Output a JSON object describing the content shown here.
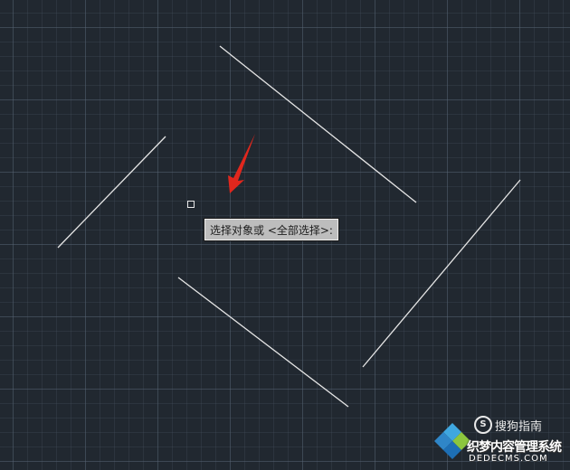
{
  "canvas": {
    "background_color": "#212830",
    "line_color": "#e6e6e6",
    "arrow_color": "#e0271d"
  },
  "prompt": {
    "text": "选择对象或 <全部选择>:"
  },
  "watermark": {
    "sogou_badge": "S",
    "sogou_text": "搜狗指南",
    "title": "织梦内容管理系统",
    "domain": "DEDECMS.COM"
  }
}
